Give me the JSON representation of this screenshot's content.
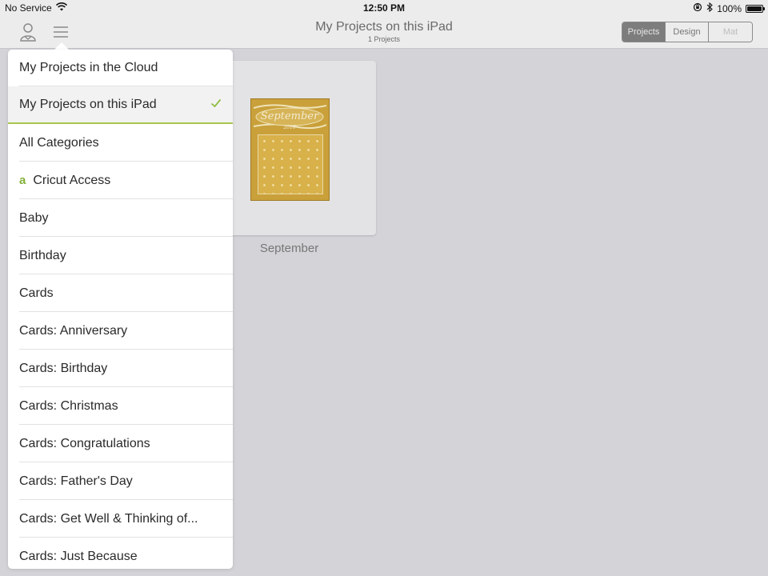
{
  "status_bar": {
    "carrier": "No Service",
    "time": "12:50 PM",
    "battery": "100%",
    "battery_level": 1.0
  },
  "navbar": {
    "title": "My Projects on this iPad",
    "subtitle": "1 Projects",
    "segments": [
      {
        "label": "Projects",
        "state": "active"
      },
      {
        "label": "Design",
        "state": "enabled"
      },
      {
        "label": "Mat",
        "state": "disabled"
      }
    ]
  },
  "project_card": {
    "caption": "September",
    "thumb_title": "September"
  },
  "menu": {
    "items": [
      {
        "label": "My Projects in the Cloud"
      },
      {
        "label": "My Projects on this iPad",
        "selected": true
      },
      {
        "label": "All Categories"
      },
      {
        "label": "Cricut Access",
        "icon": "a"
      },
      {
        "label": "Baby"
      },
      {
        "label": "Birthday"
      },
      {
        "label": "Cards"
      },
      {
        "label": "Cards: Anniversary"
      },
      {
        "label": "Cards: Birthday"
      },
      {
        "label": "Cards: Christmas"
      },
      {
        "label": "Cards: Congratulations"
      },
      {
        "label": "Cards: Father's Day"
      },
      {
        "label": "Cards: Get Well & Thinking of..."
      },
      {
        "label": "Cards: Just Because"
      }
    ]
  },
  "colors": {
    "accent": "#a8c64a",
    "background": "#d3d3d8",
    "thumb": "#c9a03a"
  }
}
